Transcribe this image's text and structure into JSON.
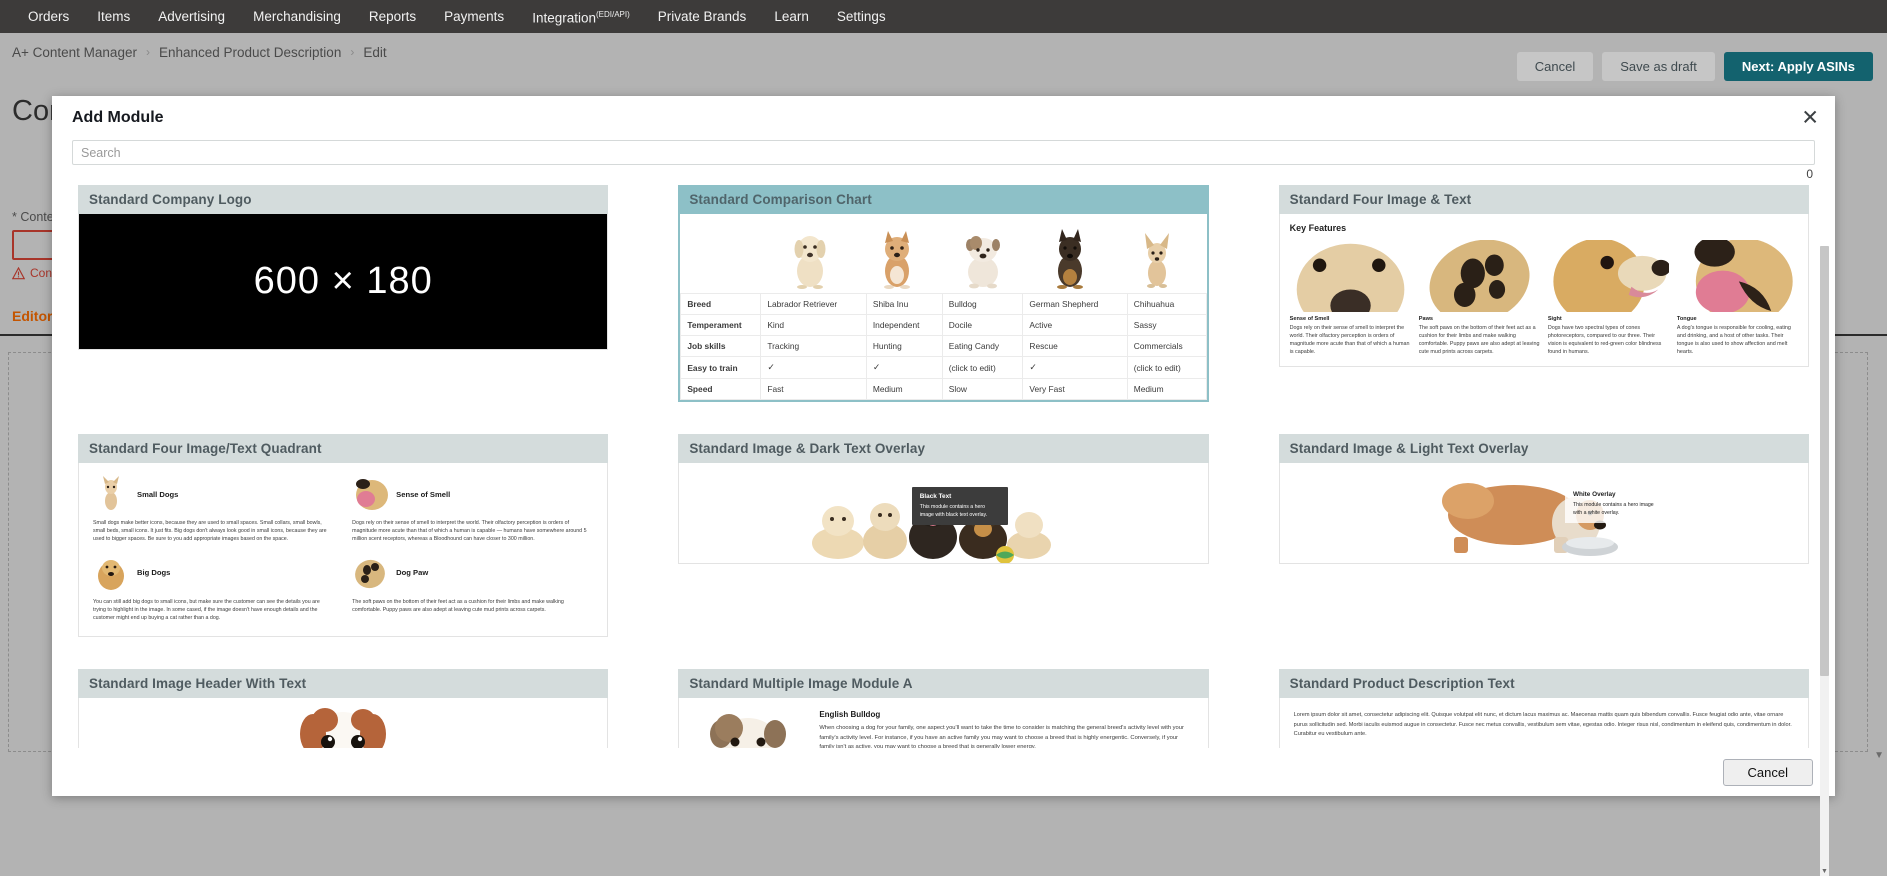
{
  "topnav": {
    "items": [
      {
        "label": "Orders"
      },
      {
        "label": "Items"
      },
      {
        "label": "Advertising"
      },
      {
        "label": "Merchandising"
      },
      {
        "label": "Reports"
      },
      {
        "label": "Payments"
      },
      {
        "label": "Integration",
        "sup": "(EDI/API)"
      },
      {
        "label": "Private Brands"
      },
      {
        "label": "Learn"
      },
      {
        "label": "Settings"
      }
    ]
  },
  "breadcrumb": {
    "items": [
      "A+ Content Manager",
      "Enhanced Product Description",
      "Edit"
    ],
    "separator": "›"
  },
  "actions": {
    "cancel": "Cancel",
    "save_draft": "Save as draft",
    "next": "Next: Apply ASINs",
    "accent_primary": "#13626e"
  },
  "background": {
    "page_title": "Content",
    "content_label": "* Content",
    "content_error": "Content",
    "editor_tab": "Editor",
    "error_color": "#a8352a",
    "editor_color": "#c45500"
  },
  "modal": {
    "title": "Add Module",
    "close_icon": "✕",
    "search_placeholder": "Search",
    "search_value": "",
    "counter": "0",
    "cancel_label": "Cancel"
  },
  "modules": [
    {
      "id": "standard-company-logo",
      "title": "Standard Company Logo",
      "selected": false,
      "kind": "logo",
      "placeholder": "600 × 180"
    },
    {
      "id": "standard-comparison-chart",
      "title": "Standard Comparison Chart",
      "selected": true,
      "kind": "comparison",
      "chart_data": {
        "type": "table",
        "title": "Standard Comparison Chart",
        "row_headers": [
          "Breed",
          "Temperament",
          "Job skills",
          "Easy to train",
          "Speed"
        ],
        "columns": [
          "Labrador Retriever",
          "Shiba Inu",
          "Bulldog",
          "German Shepherd",
          "Chihuahua"
        ],
        "rows": [
          {
            "header": "Breed",
            "cells": [
              "Labrador Retriever",
              "Shiba Inu",
              "Bulldog",
              "German Shepherd",
              "Chihuahua"
            ]
          },
          {
            "header": "Temperament",
            "cells": [
              "Kind",
              "Independent",
              "Docile",
              "Active",
              "Sassy"
            ]
          },
          {
            "header": "Job skills",
            "cells": [
              "Tracking",
              "Hunting",
              "Eating Candy",
              "Rescue",
              "Commercials"
            ]
          },
          {
            "header": "Easy to train",
            "cells": [
              "✓",
              "✓",
              "(click to edit)",
              "✓",
              "(click to edit)"
            ]
          },
          {
            "header": "Speed",
            "cells": [
              "Fast",
              "Medium",
              "Slow",
              "Very Fast",
              "Medium"
            ]
          }
        ]
      }
    },
    {
      "id": "standard-four-image-text",
      "title": "Standard Four Image & Text",
      "selected": false,
      "kind": "four-image-text",
      "heading": "Key Features",
      "items": [
        {
          "caption": "Sense of Smell",
          "body": "Dogs rely on their sense of smell to interpret the world. Their olfactory perception is orders of magnitude more acute than that of which a human is capable."
        },
        {
          "caption": "Paws",
          "body": "The soft paws on the bottom of their feet act as a cushion for their limbs and make walking comfortable. Puppy paws are also adept at leaving cute mud prints across carpets."
        },
        {
          "caption": "Sight",
          "body": "Dogs have two spectral types of cones photoreceptors, compared to our three. Their vision is equivalent to red-green color blindness found in humans."
        },
        {
          "caption": "Tongue",
          "body": "A dog's tongue is responsible for cooling, eating and drinking, and a host of other tasks. Their tongue is also used to show affection and melt hearts."
        }
      ]
    },
    {
      "id": "standard-four-image-text-quadrant",
      "title": "Standard Four Image/Text Quadrant",
      "selected": false,
      "kind": "quadrant",
      "items": [
        {
          "caption": "Small Dogs",
          "body": "Small dogs make better icons, because they are used to small spaces. Small collars, small bowls, small beds, small icons. It just fits. Big dogs don't always look good in small icons, because they are used to bigger spaces. Be sure to you add appropriate images based on the space."
        },
        {
          "caption": "Sense of Smell",
          "body": "Dogs rely on their sense of smell to interpret the world. Their olfactory perception is orders of magnitude more acute than that of which a human is capable — humans have somewhere around 5 million scent receptors, whereas a Bloodhound can have closer to 300 million."
        },
        {
          "caption": "Big Dogs",
          "body": "You can still add big dogs to small icons, but make sure the customer can see the details you are trying to highlight in the image. In some cased, if the image doesn't have enough details and the customer might end up buying a cat rather than a dog."
        },
        {
          "caption": "Dog Paw",
          "body": "The soft paws on the bottom of their feet act as a cushion for their limbs and make walking comfortable. Puppy paws are also adept at leaving cute mud prints across carpets."
        }
      ]
    },
    {
      "id": "standard-image-dark-text-overlay",
      "title": "Standard Image & Dark Text Overlay",
      "selected": false,
      "kind": "hero-dark",
      "overlay_heading": "Black Text",
      "overlay_body": "This module contains a hero image with black text overlay."
    },
    {
      "id": "standard-image-light-text-overlay",
      "title": "Standard Image & Light Text Overlay",
      "selected": false,
      "kind": "hero-light",
      "overlay_heading": "White Overlay",
      "overlay_body": "This module contains a hero image with a white overlay."
    },
    {
      "id": "standard-image-header-with-text",
      "title": "Standard Image Header With Text",
      "selected": false,
      "kind": "image-header"
    },
    {
      "id": "standard-multiple-image-module-a",
      "title": "Standard Multiple Image Module A",
      "selected": false,
      "kind": "multi-image",
      "heading": "English Bulldog",
      "body": "When choosing a dog for your family, one aspect you'll want to take the time to consider is matching the general breed's activity level with your family's activity level. For instance, if you have an active family you may want to choose a breed that is highly energentic. Conversely, if your family isn't as active, you may want to choose a breed that is generally lower energy."
    },
    {
      "id": "standard-product-description-text",
      "title": "Standard Product Description Text",
      "selected": false,
      "kind": "description",
      "body": "Lorem ipsum dolor sit amet, consectetur adipiscing elit. Quisque volutpat elit nunc, et dictum lacus maximus ac. Maecenas mattis quam quis bibendum convallis. Fusce feugiat odio ante, vitae ornare purus sollicitudin sed. Morbi iaculis euismod augue in consectetur. Fusce nec metus convallis, vestibulum sem vitae, egestas odio. Integer risus nisl, condimentum in eleifend quis, condimentum in dolor. Curabitur eu vestibulum ante."
    }
  ]
}
